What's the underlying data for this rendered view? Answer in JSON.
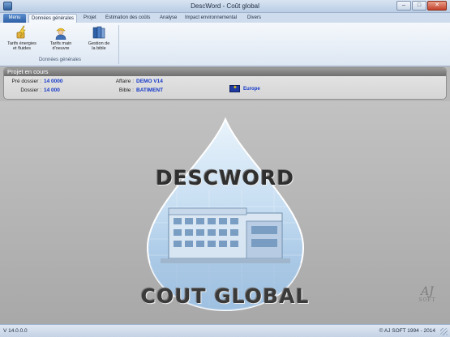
{
  "window": {
    "title": "DescWord - Coût global",
    "minimize": "–",
    "maximize": "□",
    "close": "✕"
  },
  "ribbon": {
    "tabs": [
      {
        "label": "Menu"
      },
      {
        "label": "Données générales"
      },
      {
        "label": "Projet"
      },
      {
        "label": "Estimation des coûts"
      },
      {
        "label": "Analyse"
      },
      {
        "label": "Impact environnemental"
      },
      {
        "label": "Divers"
      }
    ],
    "active_tab": "Données générales",
    "buttons": [
      {
        "line1": "Tarifs énergies",
        "line2": "et fluides",
        "icon": "lightning-icon"
      },
      {
        "line1": "Tarifs main",
        "line2": "d'oeuvre",
        "icon": "worker-icon"
      },
      {
        "line1": "Gestion de",
        "line2": "la bible",
        "icon": "book-icon"
      }
    ],
    "group_label": "Données générales"
  },
  "project_panel": {
    "title": "Projet en cours",
    "pre_dossier_label": "Pré dossier :",
    "pre_dossier_value": "14 0000",
    "dossier_label": "Dossier :",
    "dossier_value": "14 000",
    "affaire_label": "Affaire :",
    "affaire_value": "DEMO V14",
    "bible_label": "Bible :",
    "bible_value": "BATIMENT",
    "region": "Europe"
  },
  "splash": {
    "title_top": "DESCWORD",
    "title_bottom": "COUT GLOBAL",
    "logo_mark": "AJ",
    "logo_text": "SOFT"
  },
  "statusbar": {
    "version": "V 14.0.0.0",
    "copyright": "© AJ SOFT 1994 - 2014"
  },
  "colors": {
    "value_blue": "#1438c8",
    "menu_tab": "#2e5fa5",
    "panel_header": "#7a7a7a"
  }
}
